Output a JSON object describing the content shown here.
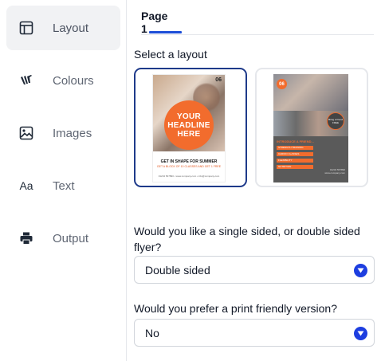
{
  "sidebar": {
    "items": [
      {
        "label": "Layout",
        "icon": "layout-icon",
        "active": true
      },
      {
        "label": "Colours",
        "icon": "paint-brush-icon",
        "active": false
      },
      {
        "label": "Images",
        "icon": "image-icon",
        "active": false
      },
      {
        "label": "Text",
        "icon": "text-icon",
        "active": false
      },
      {
        "label": "Output",
        "icon": "printer-icon",
        "active": false
      }
    ],
    "text_icon_glyph": "Aa"
  },
  "tabs": [
    {
      "label": "Page 1",
      "active": true
    }
  ],
  "layout_section": {
    "label": "Select a layout",
    "options": [
      {
        "selected": true,
        "flyer": {
          "logo": "06",
          "headline": [
            "YOUR",
            "HEADLINE",
            "HERE"
          ],
          "sub": "GET IN SHAPE FOR SUMMER",
          "sub2": "GET A BLOCK OF 10 CLASSES AND GET 1 FREE",
          "footer": "01234 567890 • www.company.com • info@company.com"
        }
      },
      {
        "selected": false,
        "flyer": {
          "logo": "06",
          "heading": "INTRODUCE A FRIEND...",
          "bars": [
            "STRENGTH TRAINING",
            "CARDIO CLASSES",
            "FLEXIBILITY",
            "NUTRITION"
          ],
          "badge": "Bring a friend FREE",
          "contact": "01234 567890 www.company.com"
        }
      }
    ]
  },
  "questions": [
    {
      "label": "Would you like a single sided, or double sided flyer?",
      "value": "Double sided"
    },
    {
      "label": "Would you prefer a print friendly version?",
      "value": "No"
    }
  ],
  "colors": {
    "accent_blue": "#1d3ee0",
    "selected_border": "#1e3a8a",
    "tab_indicator": "#1d4ed8",
    "flyer_orange": "#f26c2d"
  }
}
